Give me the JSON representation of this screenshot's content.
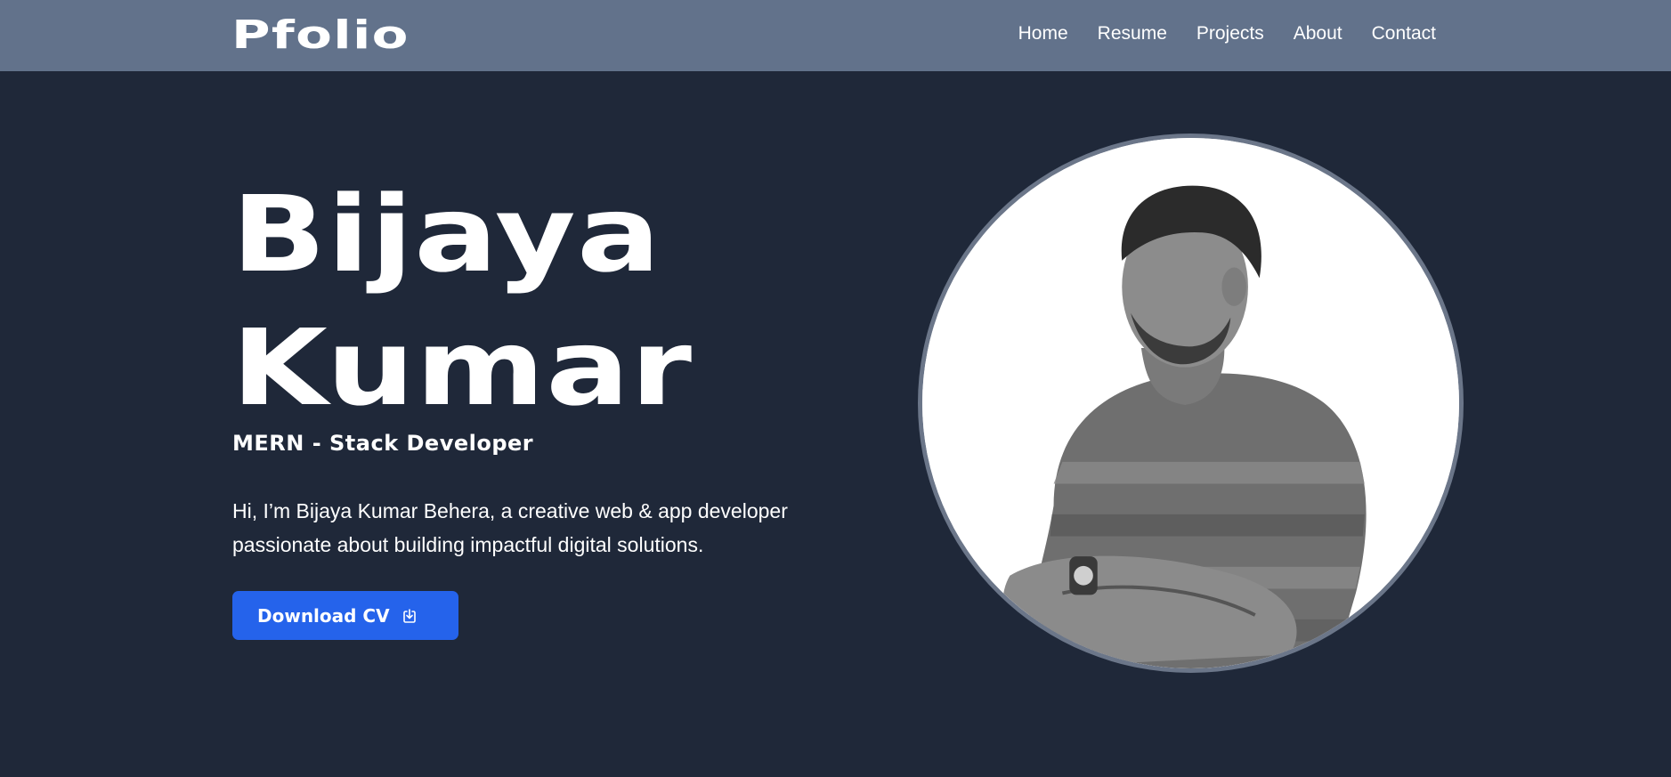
{
  "nav": {
    "logo": "Pfolio",
    "links": [
      "Home",
      "Resume",
      "Projects",
      "About",
      "Contact"
    ]
  },
  "hero": {
    "first_name": "Bijaya",
    "last_name": "Kumar",
    "role": "MERN - Stack Developer",
    "bio": "Hi, I’m Bijaya Kumar Behera, a creative web & app developer passionate about building impactful digital solutions.",
    "cta_label": "Download CV",
    "cta_icon": "download-icon"
  },
  "colors": {
    "navbar_bg": "#62728b",
    "page_bg": "#1f2839",
    "accent": "#2563eb",
    "portrait_border": "#6b7689"
  }
}
